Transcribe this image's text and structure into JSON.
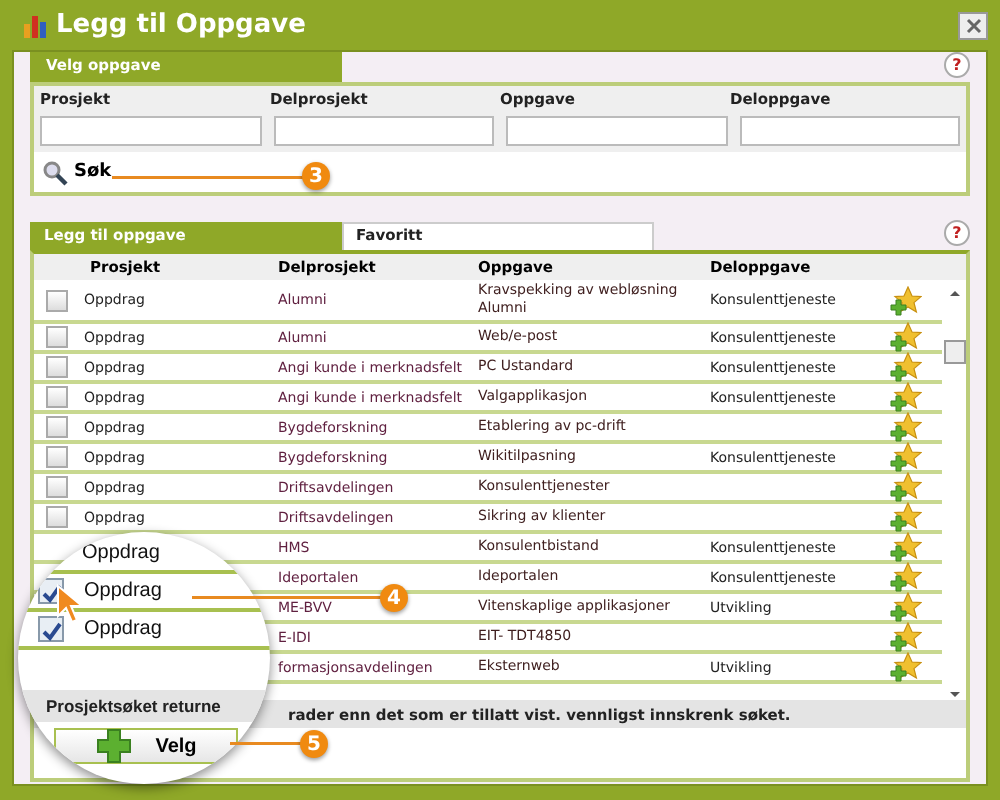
{
  "window": {
    "title": "Legg til Oppgave"
  },
  "search_panel": {
    "tab": "Velg oppgave",
    "fields": [
      {
        "label": "Prosjekt"
      },
      {
        "label": "Delprosjekt"
      },
      {
        "label": "Oppgave"
      },
      {
        "label": "Deloppgave"
      }
    ],
    "search_button": "Søk",
    "help": "?"
  },
  "tab_help": "?",
  "tabs": [
    {
      "label": "Legg til oppgave",
      "selected": true
    },
    {
      "label": "Favoritt",
      "selected": false
    }
  ],
  "table": {
    "columns": [
      "Prosjekt",
      "Delprosjekt",
      "Oppgave",
      "Deloppgave"
    ],
    "rows": [
      {
        "checked": false,
        "project": "Oppdrag",
        "subproject": "Alumni",
        "task": "Kravspekking av webløsning Alumni",
        "subtask": "Konsulenttjeneste"
      },
      {
        "checked": false,
        "project": "Oppdrag",
        "subproject": "Alumni",
        "task": "Web/e-post",
        "subtask": "Konsulenttjeneste"
      },
      {
        "checked": false,
        "project": "Oppdrag",
        "subproject": "Angi kunde i merknadsfelt",
        "task": "PC Ustandard",
        "subtask": "Konsulenttjeneste"
      },
      {
        "checked": false,
        "project": "Oppdrag",
        "subproject": "Angi kunde i merknadsfelt",
        "task": "Valgapplikasjon",
        "subtask": "Konsulenttjeneste"
      },
      {
        "checked": false,
        "project": "Oppdrag",
        "subproject": "Bygdeforskning",
        "task": "Etablering av pc-drift"
      },
      {
        "checked": false,
        "project": "Oppdrag",
        "subproject": "Bygdeforskning",
        "task": "Wikitilpasning",
        "subtask": "Konsulenttjeneste"
      },
      {
        "checked": false,
        "project": "Oppdrag",
        "subproject": "Driftsavdelingen",
        "task": "Konsulenttjenester"
      },
      {
        "checked": false,
        "project": "Oppdrag",
        "subproject": "Driftsavdelingen",
        "task": "Sikring av klienter"
      },
      {
        "subproject": "HMS",
        "task": "Konsulentbistand",
        "subtask": "Konsulenttjeneste"
      },
      {
        "subproject": "Ideportalen",
        "task": "Ideportalen",
        "subtask": "Konsulenttjeneste"
      },
      {
        "subproject": "ME-BVV",
        "task": "Vitenskaplige applikasjoner",
        "subtask": "Utvikling"
      },
      {
        "subproject": "E-IDI",
        "task": "EIT- TDT4850"
      },
      {
        "subproject": "formasjonsavdelingen",
        "task": "Eksternweb",
        "subtask": "Utvikling"
      }
    ],
    "status": "rader enn det som er tillatt vist. vennligst innskrenk søket."
  },
  "magnifier": {
    "rows": [
      {
        "label": "Oppdrag"
      },
      {
        "label": "Oppdrag",
        "checked": true
      },
      {
        "label": "Oppdrag",
        "checked": true
      }
    ],
    "status": "Prosjektsøket returne",
    "button": "Velg"
  },
  "callouts": [
    "3",
    "4",
    "5"
  ]
}
